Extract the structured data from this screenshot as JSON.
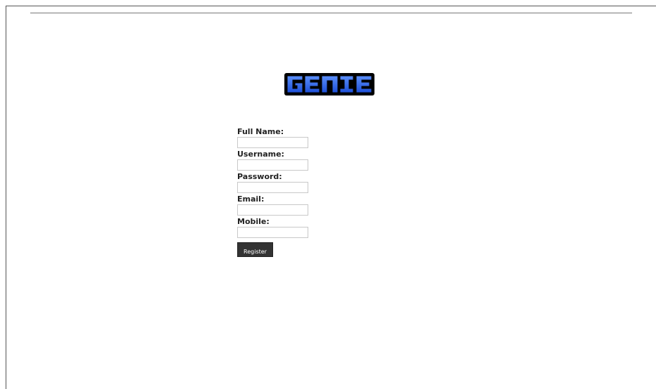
{
  "logo": {
    "text": "GENIE",
    "fill_color": "#2f6df6",
    "outline_color": "#000000"
  },
  "form": {
    "fields": [
      {
        "label": "Full Name:",
        "value": "",
        "placeholder": ""
      },
      {
        "label": "Username:",
        "value": "",
        "placeholder": ""
      },
      {
        "label": "Password:",
        "value": "",
        "placeholder": ""
      },
      {
        "label": "Email:",
        "value": "",
        "placeholder": ""
      },
      {
        "label": "Mobile:",
        "value": "",
        "placeholder": ""
      }
    ],
    "submit_label": "Register"
  },
  "colors": {
    "button_background": "#333333",
    "input_border": "#c8c8c8",
    "rule": "#777777"
  }
}
